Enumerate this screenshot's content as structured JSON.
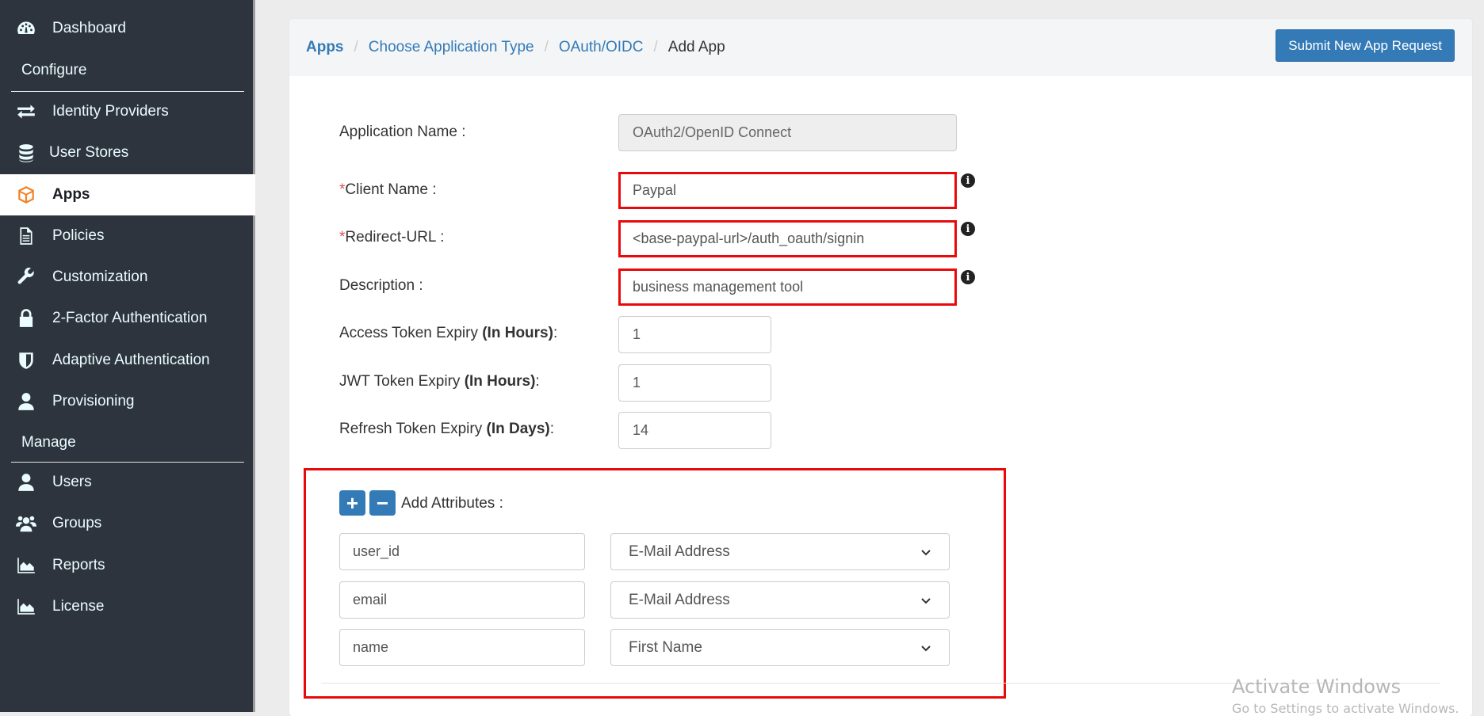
{
  "sidebar": {
    "items": [
      {
        "label": "Dashboard",
        "icon": "dashboard-icon"
      },
      {
        "label": "Identity Providers",
        "icon": "exchange-icon"
      },
      {
        "label": "User Stores",
        "icon": "database-icon"
      },
      {
        "label": "Apps",
        "icon": "cube-icon",
        "active": true
      },
      {
        "label": "Policies",
        "icon": "file-text-icon"
      },
      {
        "label": "Customization",
        "icon": "wrench-icon"
      },
      {
        "label": "2-Factor Authentication",
        "icon": "lock-icon"
      },
      {
        "label": "Adaptive Authentication",
        "icon": "shield-icon"
      },
      {
        "label": "Provisioning",
        "icon": "user-icon"
      },
      {
        "label": "Users",
        "icon": "user-icon"
      },
      {
        "label": "Groups",
        "icon": "users-icon"
      },
      {
        "label": "Reports",
        "icon": "area-chart-icon"
      },
      {
        "label": "License",
        "icon": "area-chart-icon"
      }
    ],
    "sections": {
      "configure": "Configure",
      "manage": "Manage"
    }
  },
  "breadcrumb": {
    "items": [
      "Apps",
      "Choose Application Type",
      "OAuth/OIDC"
    ],
    "current": "Add App",
    "separator": "/"
  },
  "header": {
    "submit_label": "Submit New App Request"
  },
  "form": {
    "application_name": {
      "label": "Application Name :",
      "value": "OAuth2/OpenID Connect"
    },
    "client_name": {
      "required_mark": "*",
      "label": "Client Name :",
      "value": "Paypal"
    },
    "redirect_url": {
      "required_mark": "*",
      "label": "Redirect-URL :",
      "value": "<base-paypal-url>/auth_oauth/signin"
    },
    "description": {
      "label": "Description :",
      "value": "business management tool"
    },
    "access_token": {
      "label": "Access Token Expiry ",
      "unit": "(In Hours)",
      "suffix": ":",
      "value": "1"
    },
    "jwt_token": {
      "label": "JWT Token Expiry ",
      "unit": "(In Hours)",
      "suffix": ":",
      "value": "1"
    },
    "refresh_token": {
      "label": "Refresh Token Expiry ",
      "unit": "(In Days)",
      "suffix": ":",
      "value": "14"
    }
  },
  "attributes": {
    "label": "Add Attributes :",
    "add_symbol": "+",
    "remove_symbol": "−",
    "rows": [
      {
        "name": "user_id",
        "mapping": "E-Mail Address"
      },
      {
        "name": "email",
        "mapping": "E-Mail Address"
      },
      {
        "name": "name",
        "mapping": "First Name"
      }
    ]
  },
  "watermark": {
    "title": "Activate Windows",
    "subtitle": "Go to Settings to activate Windows."
  },
  "colors": {
    "accent": "#337ab7",
    "sidebar_bg": "#2e343d",
    "active_icon": "#f08123",
    "highlight": "#e80a0a",
    "required": "#d9534f"
  }
}
